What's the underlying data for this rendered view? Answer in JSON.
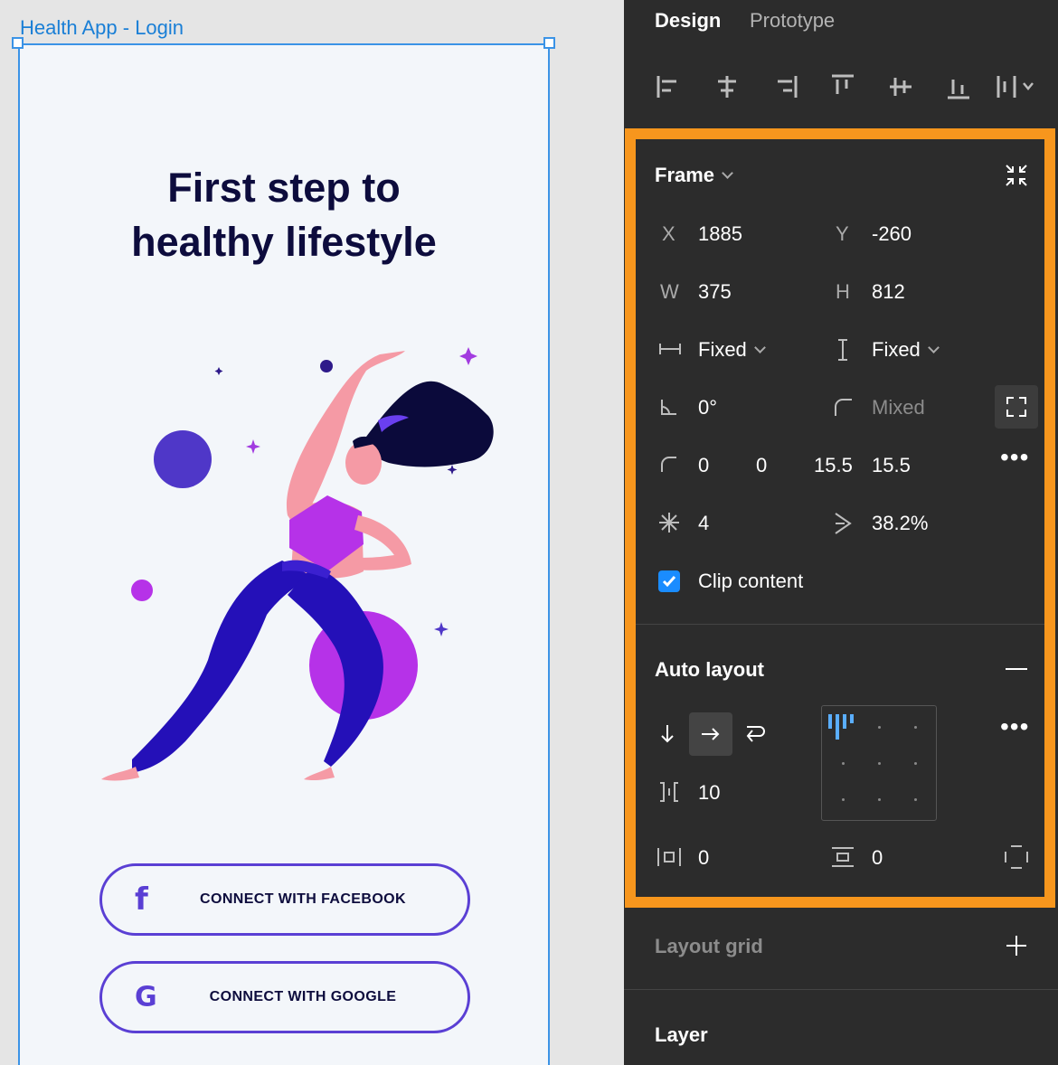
{
  "canvas": {
    "frame_name": "Health App - Login",
    "heading_line1": "First step to",
    "heading_line2": "healthy lifestyle",
    "facebook_button": "CONNECT WITH FACEBOOK",
    "google_button": "CONNECT WITH GOOGLE",
    "facebook_icon_glyph": "f",
    "google_icon_glyph": "G"
  },
  "panel": {
    "tabs": [
      "Design",
      "Prototype"
    ],
    "frame": {
      "title": "Frame",
      "x_label": "X",
      "x_value": "1885",
      "y_label": "Y",
      "y_value": "-260",
      "w_label": "W",
      "w_value": "375",
      "h_label": "H",
      "h_value": "812",
      "width_mode": "Fixed",
      "height_mode": "Fixed",
      "rotation": "0°",
      "corner_radius": "Mixed",
      "corners": [
        "0",
        "0",
        "15.5",
        "15.5"
      ],
      "star_count": "4",
      "ratio": "38.2%",
      "clip_label": "Clip content",
      "clip_checked": true
    },
    "auto_layout": {
      "title": "Auto layout",
      "spacing": "10",
      "padding_horizontal": "0",
      "padding_vertical": "0"
    },
    "layout_grid_title": "Layout grid",
    "layer_title": "Layer"
  },
  "colors": {
    "selection": "#3b93e6",
    "highlight": "#f7961d",
    "button_border": "#5a3fd4",
    "heading": "#0d0c3d",
    "panel_bg": "#2c2c2c",
    "checkbox": "#1a8cff"
  }
}
